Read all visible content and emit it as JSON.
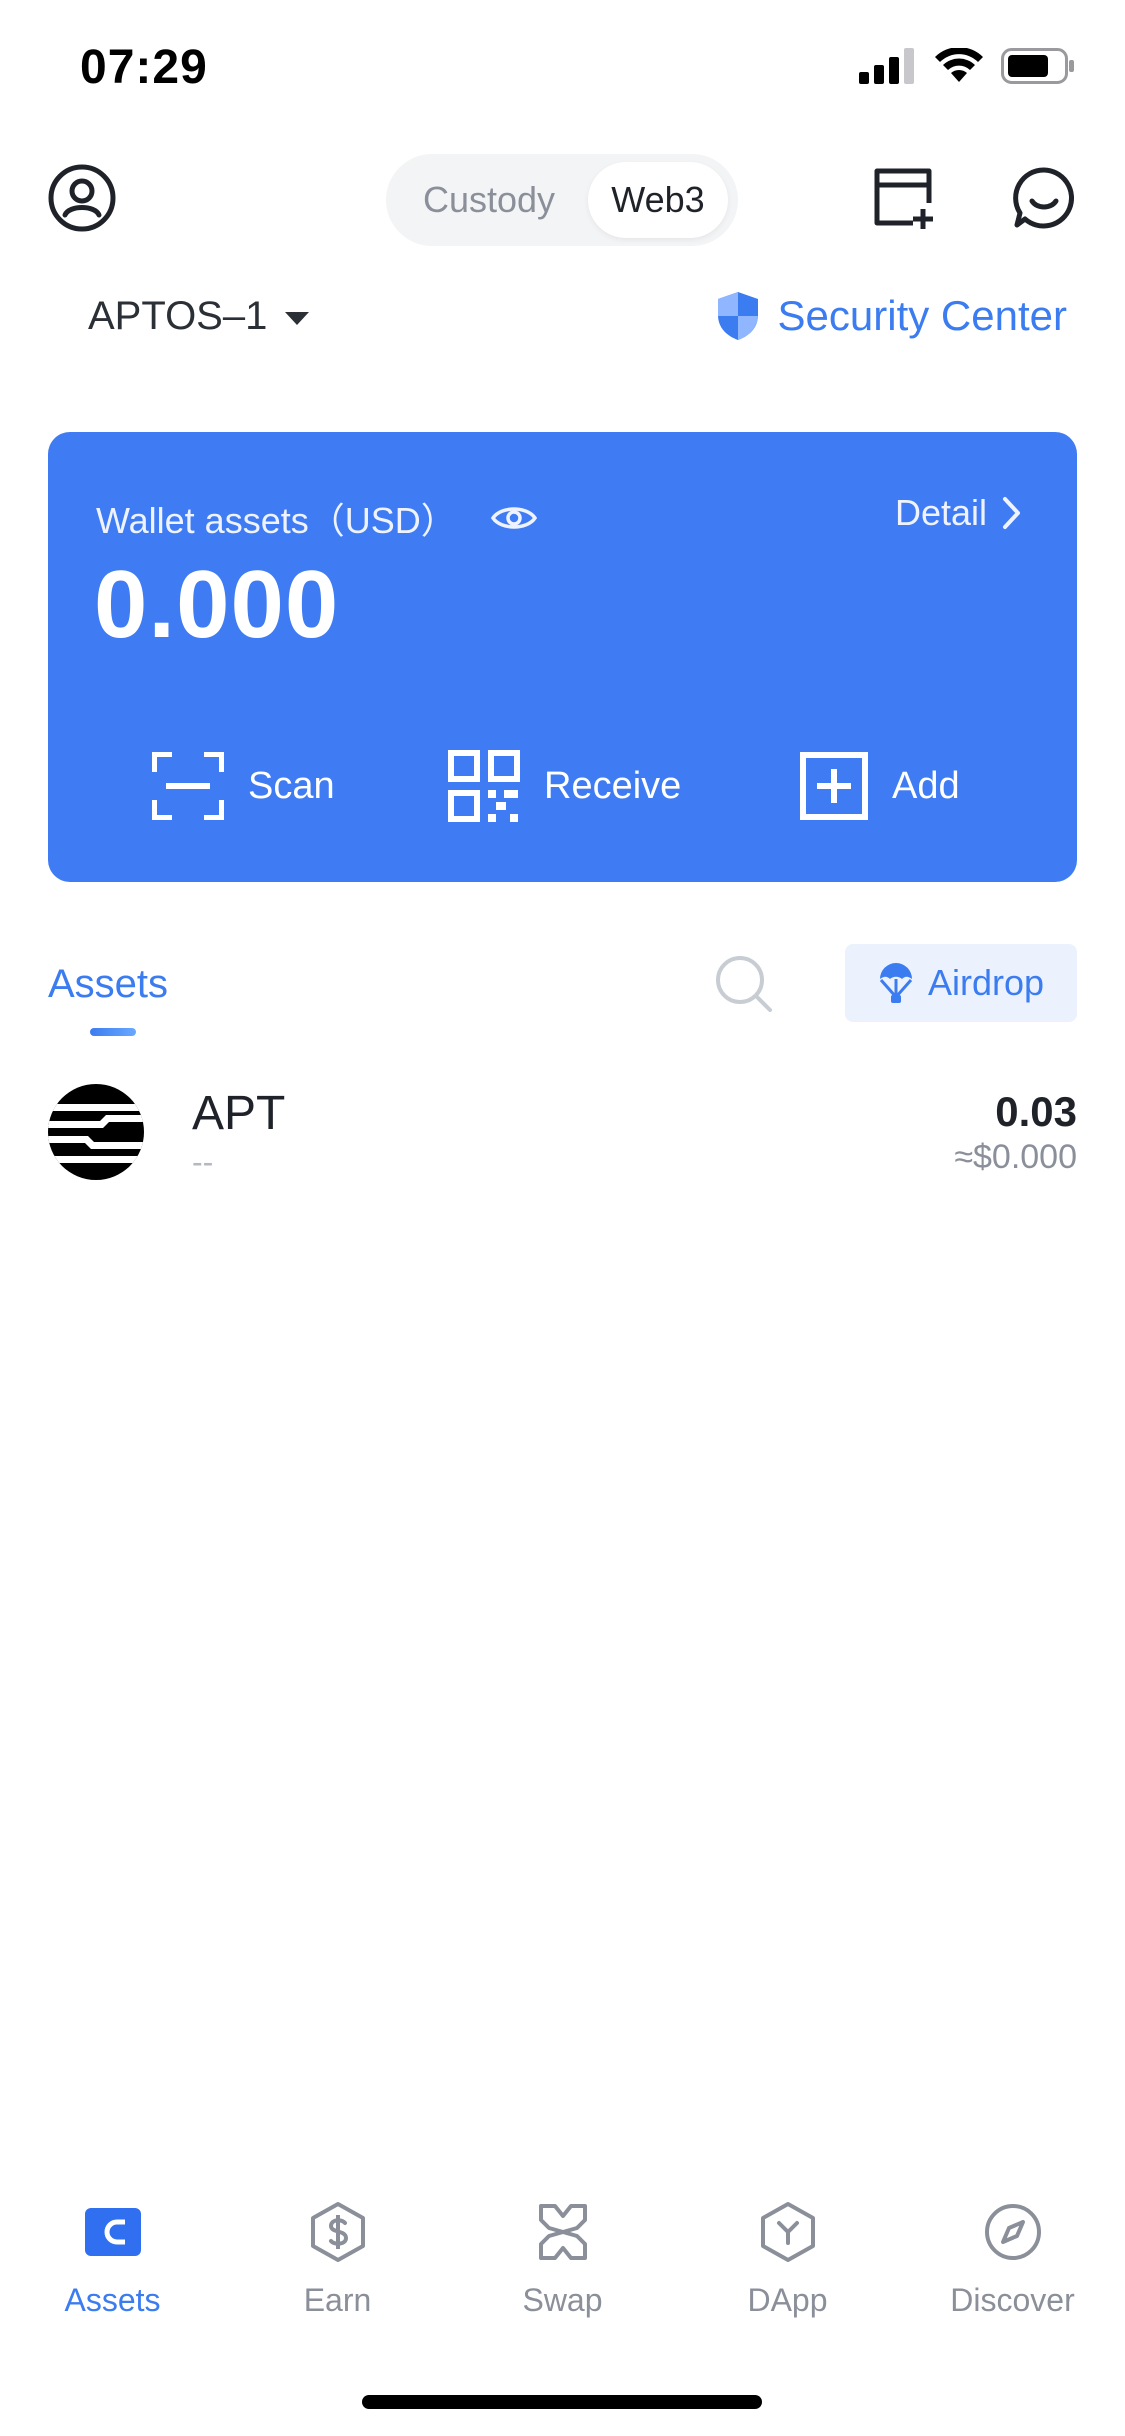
{
  "status_bar": {
    "time": "07:29"
  },
  "header": {
    "segments": [
      {
        "label": "Custody",
        "active": false
      },
      {
        "label": "Web3",
        "active": true
      }
    ],
    "icons": [
      "user-icon",
      "add-card-icon",
      "chat-icon"
    ]
  },
  "network": {
    "name": "APTOS–1"
  },
  "security": {
    "label": "Security Center"
  },
  "wallet_card": {
    "label": "Wallet assets（USD）",
    "detail_label": "Detail",
    "value": "0.000",
    "actions": [
      {
        "label": "Scan",
        "icon": "scan-icon"
      },
      {
        "label": "Receive",
        "icon": "qr-code-icon"
      },
      {
        "label": "Add",
        "icon": "add-icon"
      }
    ]
  },
  "assets_section": {
    "tab_label": "Assets",
    "airdrop_label": "Airdrop",
    "items": [
      {
        "symbol": "APT",
        "subtitle": "--",
        "amount": "0.03",
        "usd_value": "≈$0.000"
      }
    ]
  },
  "bottom_nav": {
    "items": [
      {
        "label": "Assets",
        "icon": "wallet-icon",
        "active": true
      },
      {
        "label": "Earn",
        "icon": "dollar-hex-icon",
        "active": false
      },
      {
        "label": "Swap",
        "icon": "swap-icon",
        "active": false
      },
      {
        "label": "DApp",
        "icon": "dapp-hex-icon",
        "active": false
      },
      {
        "label": "Discover",
        "icon": "compass-icon",
        "active": false
      }
    ]
  },
  "colors": {
    "accent": "#3f7cf3",
    "link": "#3b7cf0",
    "muted": "#8a8f99"
  }
}
